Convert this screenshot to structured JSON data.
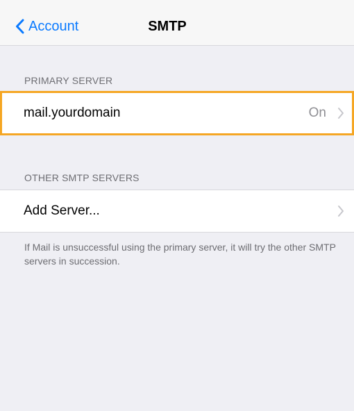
{
  "nav": {
    "back_label": "Account",
    "title": "SMTP"
  },
  "primary_server": {
    "header": "PRIMARY SERVER",
    "name": "mail.yourdomain",
    "status": "On"
  },
  "other_servers": {
    "header": "OTHER SMTP SERVERS",
    "add_label": "Add Server..."
  },
  "footer_note": "If Mail is unsuccessful using the primary server, it will try the other SMTP servers in succession.",
  "colors": {
    "accent": "#0a7aff",
    "highlight_border": "#f5a623",
    "background": "#efeff4"
  }
}
